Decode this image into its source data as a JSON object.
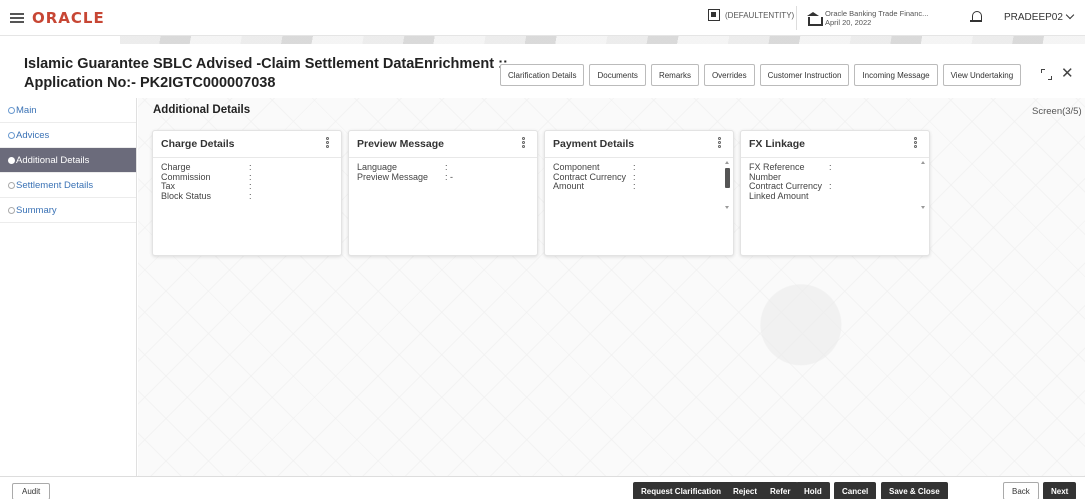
{
  "app": {
    "logo": "ORACLE"
  },
  "header": {
    "entity": "(DEFAULTENTITY)",
    "branch_name": "Oracle Banking Trade Financ...",
    "branch_date": "April 20, 2022",
    "user": "PRADEEP02"
  },
  "page": {
    "title_line1": "Islamic Guarantee SBLC Advised -Claim Settlement DataEnrichment ::",
    "title_line2": "Application No:- PK2IGTC000007038",
    "buttons": [
      "Clarification Details",
      "Documents",
      "Remarks",
      "Overrides",
      "Customer Instruction",
      "Incoming Message",
      "View Undertaking"
    ]
  },
  "sidebar": {
    "items": [
      {
        "label": "Main",
        "state": "done"
      },
      {
        "label": "Advices",
        "state": "done"
      },
      {
        "label": "Additional Details",
        "state": "active"
      },
      {
        "label": "Settlement Details",
        "state": "pending"
      },
      {
        "label": "Summary",
        "state": "pending"
      }
    ]
  },
  "main": {
    "section_title": "Additional Details",
    "screen": "Screen(3/5)",
    "cards": [
      {
        "title": "Charge Details",
        "rows": [
          {
            "label": "Charge",
            "value": ":"
          },
          {
            "label": "Commission",
            "value": ":"
          },
          {
            "label": "Tax",
            "value": ":"
          },
          {
            "label": "Block Status",
            "value": ":"
          }
        ]
      },
      {
        "title": "Preview Message",
        "rows": [
          {
            "label": "Language",
            "value": ":"
          },
          {
            "label": "Preview Message",
            "value": ": -"
          }
        ]
      },
      {
        "title": "Payment Details",
        "rows": [
          {
            "label": "Component",
            "value": ":"
          },
          {
            "label": "Contract Currency",
            "value": ":"
          },
          {
            "label": "Amount",
            "value": ":"
          }
        ]
      },
      {
        "title": "FX Linkage",
        "rows": [
          {
            "label": "FX Reference",
            "value": ":"
          },
          {
            "label": "Number",
            "value": ""
          },
          {
            "label": "Contract Currency",
            "value": ":"
          },
          {
            "label": "Linked Amount",
            "value": ""
          }
        ]
      }
    ]
  },
  "footer": {
    "audit": "Audit",
    "request_clarification": "Request Clarification",
    "reject": "Reject",
    "refer": "Refer",
    "hold": "Hold",
    "cancel": "Cancel",
    "save_close": "Save & Close",
    "back": "Back",
    "next": "Next"
  }
}
